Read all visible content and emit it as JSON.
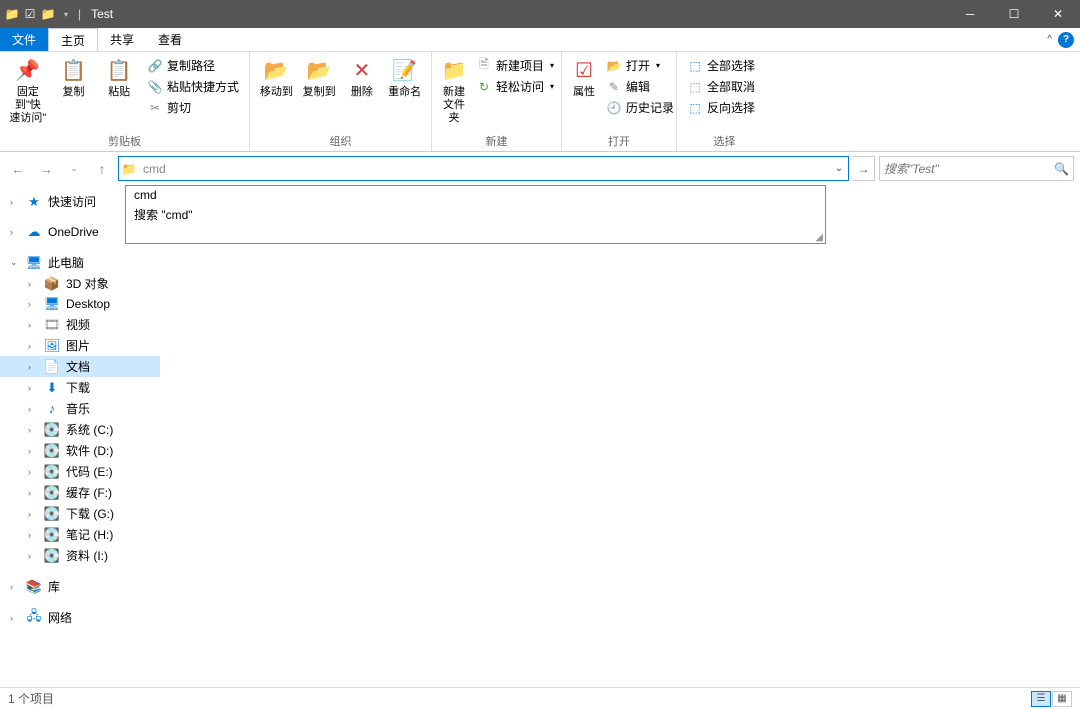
{
  "title": "Test",
  "menutabs": {
    "file": "文件",
    "home": "主页",
    "share": "共享",
    "view": "查看"
  },
  "ribbon": {
    "clipboard": {
      "pin": "固定到\"快\n速访问\"",
      "copy": "复制",
      "paste": "粘贴",
      "copypath": "复制路径",
      "pasteshortcut": "粘贴快捷方式",
      "cut": "剪切",
      "label": "剪贴板"
    },
    "organize": {
      "moveto": "移动到",
      "copyto": "复制到",
      "delete": "删除",
      "rename": "重命名",
      "label": "组织"
    },
    "new": {
      "newfolder": "新建\n文件夹",
      "newitem": "新建项目",
      "easyaccess": "轻松访问",
      "label": "新建"
    },
    "open": {
      "properties": "属性",
      "open": "打开",
      "edit": "编辑",
      "history": "历史记录",
      "label": "打开"
    },
    "select": {
      "selectall": "全部选择",
      "selectnone": "全部取消",
      "invert": "反向选择",
      "label": "选择"
    }
  },
  "address": {
    "typed": "cmd",
    "suggestions": [
      "cmd",
      "搜索 \"cmd\""
    ]
  },
  "search": {
    "placeholder": "搜索\"Test\""
  },
  "sidebar": {
    "quickaccess": "快速访问",
    "onedrive": "OneDrive",
    "thispc": "此电脑",
    "items": [
      {
        "label": "3D 对象",
        "ic": "📦",
        "cls": "blue-ic"
      },
      {
        "label": "Desktop",
        "ic": "🖥",
        "cls": "blue-ic"
      },
      {
        "label": "视频",
        "ic": "🎞",
        "cls": "gray-ic"
      },
      {
        "label": "图片",
        "ic": "🖼",
        "cls": "blue-ic"
      },
      {
        "label": "文档",
        "ic": "📄",
        "cls": "blue-ic",
        "selected": true
      },
      {
        "label": "下载",
        "ic": "⬇",
        "cls": "blue-ic"
      },
      {
        "label": "音乐",
        "ic": "♪",
        "cls": "blue-ic"
      },
      {
        "label": "系统 (C:)",
        "ic": "💽",
        "cls": "gray-ic"
      },
      {
        "label": "软件 (D:)",
        "ic": "💽",
        "cls": "gray-ic"
      },
      {
        "label": "代码 (E:)",
        "ic": "💽",
        "cls": "gray-ic"
      },
      {
        "label": "缓存 (F:)",
        "ic": "💽",
        "cls": "gray-ic"
      },
      {
        "label": "下载 (G:)",
        "ic": "💽",
        "cls": "gray-ic"
      },
      {
        "label": "笔记 (H:)",
        "ic": "💽",
        "cls": "gray-ic"
      },
      {
        "label": "资料 (I:)",
        "ic": "💽",
        "cls": "gray-ic"
      }
    ],
    "libraries": "库",
    "network": "网络"
  },
  "status": "1 个项目"
}
